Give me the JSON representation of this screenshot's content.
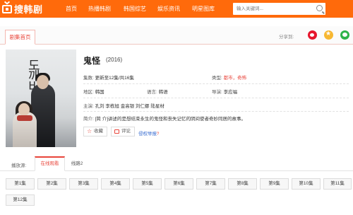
{
  "header": {
    "logo_text": "搜韩剧",
    "nav": [
      "首页",
      "热播韩剧",
      "韩国综艺",
      "娱乐资讯",
      "明星图库"
    ],
    "search_placeholder": "输入关键词..."
  },
  "section": {
    "tab_home": "剧集首页",
    "share_label": "分享到:",
    "share_icons": [
      "weibo-icon",
      "qzone-icon",
      "wechat-icon"
    ]
  },
  "poster": {
    "title_glyphs": "도깨비"
  },
  "show": {
    "title": "鬼怪",
    "year": "(2016)",
    "episodes_label": "集数:",
    "episodes_value": "更新至12集/共16集",
    "type_label": "类型:",
    "type_value": "都市，奇怖",
    "region_label": "地区:",
    "region_value": "韩国",
    "language_label": "语言:",
    "language_value": "韩语",
    "director_label": "导演:",
    "director_value": "李应福",
    "cast_label": "主演:",
    "cast_value": "孔刘 李栋旭 金高银 刘仁娜 陆星材",
    "synopsis_label": "简介:",
    "synopsis_value": "[简 介]讲述的是想结束永生的鬼怪和丧失记忆的阴间使者奇妙同居的故事。",
    "fav_label": "收藏",
    "comment_label": "评论",
    "report_label": "侵权举报"
  },
  "sources": {
    "label": "播放源:",
    "tabs": [
      "在线观看",
      "线路2"
    ]
  },
  "episodes": [
    "第1集",
    "第2集",
    "第3集",
    "第4集",
    "第5集",
    "第6集",
    "第7集",
    "第8集",
    "第9集",
    "第10集",
    "第11集",
    "第12集"
  ],
  "colors": {
    "brand": "#ff6a0b",
    "accent_red": "#e8443a",
    "link_blue": "#3b6fd1"
  }
}
